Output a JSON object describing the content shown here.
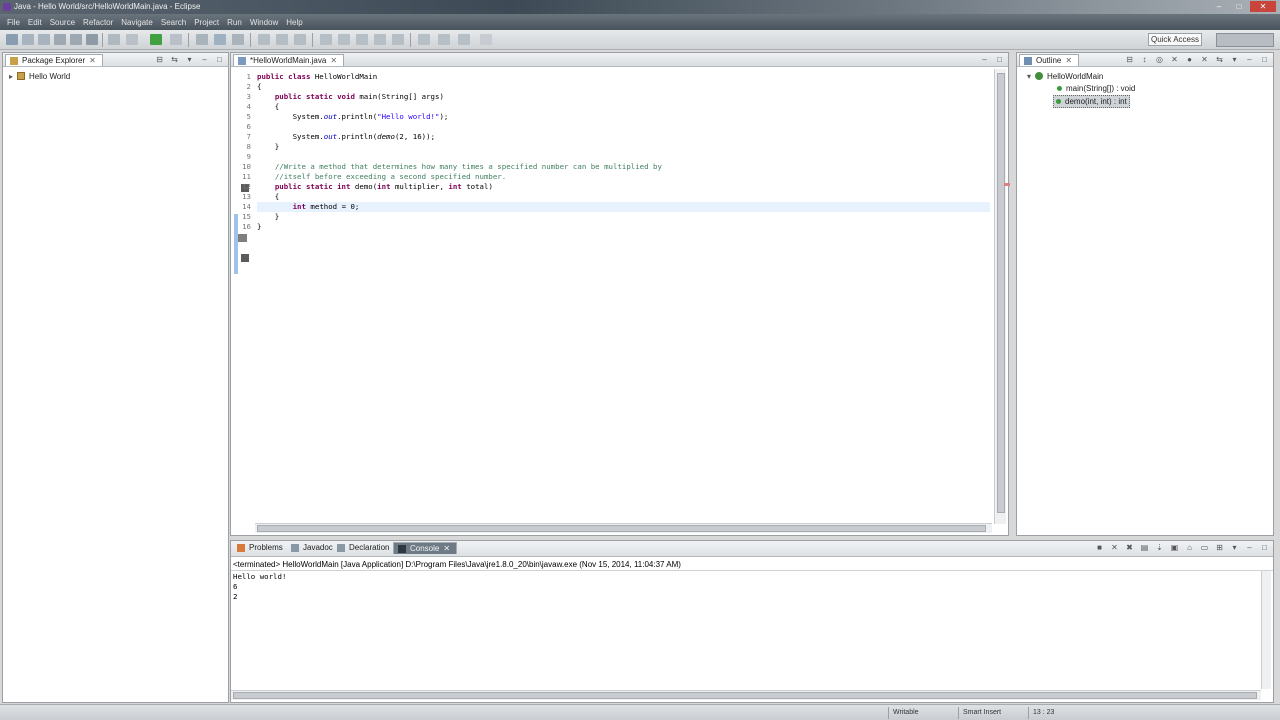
{
  "window": {
    "title": "Java - Hello World/src/HelloWorldMain.java - Eclipse",
    "min": "–",
    "max": "□",
    "close": "✕"
  },
  "menu": [
    "File",
    "Edit",
    "Source",
    "Refactor",
    "Navigate",
    "Search",
    "Project",
    "Run",
    "Window",
    "Help"
  ],
  "toolbar": {
    "quick_access": "Quick Access"
  },
  "package_explorer": {
    "tab_label": "Package Explorer",
    "tab_close": "✕",
    "project": "Hello World",
    "arrow": "▸"
  },
  "editor": {
    "tab_label": "*HelloWorldMain.java",
    "tab_close": "✕",
    "line_numbers": [
      "1",
      "2",
      "3",
      "4",
      "5",
      "6",
      "7",
      "8",
      "9",
      "10",
      "11",
      "12",
      "13",
      "14",
      "15",
      "16"
    ]
  },
  "outline": {
    "tab_label": "Outline",
    "tab_close": "✕",
    "class_name": "HelloWorldMain",
    "method_main": "main(String[]) : void",
    "method_demo": "demo(int, int) : int"
  },
  "console": {
    "tabs": [
      "Problems",
      "Javadoc",
      "Declaration",
      "Console"
    ],
    "tab_close": "✕",
    "status": "<terminated> HelloWorldMain [Java Application] D:\\Program Files\\Java\\jre1.8.0_20\\bin\\javaw.exe (Nov 15, 2014, 11:04:37 AM)",
    "output": [
      "Hello world!",
      "6",
      "2"
    ]
  },
  "statusbar": {
    "writable": "Writable",
    "insert_mode": "Smart Insert",
    "position": "13 : 23"
  }
}
